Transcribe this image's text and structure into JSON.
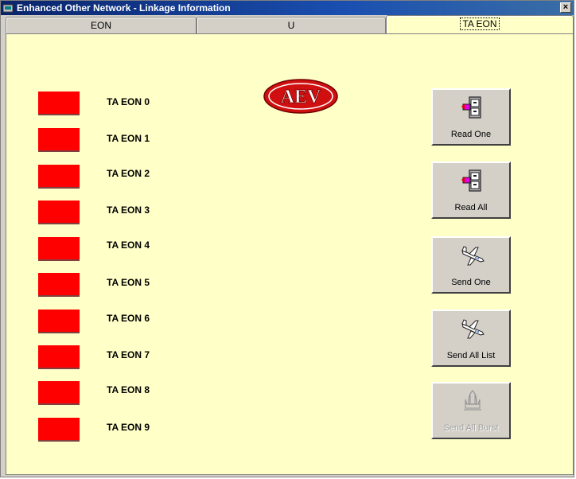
{
  "window": {
    "title": "Enhanced Other Network - Linkage Information",
    "close_glyph": "×"
  },
  "tabs": [
    {
      "label": "EON",
      "active": false
    },
    {
      "label": "U",
      "active": false
    },
    {
      "label": "TA EON",
      "active": true
    }
  ],
  "indicators": [
    {
      "label": "TA EON 0",
      "color": "#ff0000"
    },
    {
      "label": "TA EON 1",
      "color": "#ff0000"
    },
    {
      "label": "TA EON 2",
      "color": "#ff0000"
    },
    {
      "label": "TA EON 3",
      "color": "#ff0000"
    },
    {
      "label": "TA EON 4",
      "color": "#ff0000"
    },
    {
      "label": "TA EON 5",
      "color": "#ff0000"
    },
    {
      "label": "TA EON 6",
      "color": "#ff0000"
    },
    {
      "label": "TA EON 7",
      "color": "#ff0000"
    },
    {
      "label": "TA EON 8",
      "color": "#ff0000"
    },
    {
      "label": "TA EON 9",
      "color": "#ff0000"
    }
  ],
  "logo": {
    "text": "AEV",
    "icon": "aev-logo"
  },
  "buttons": [
    {
      "label": "Read One",
      "icon": "file-cabinet-icon",
      "enabled": true
    },
    {
      "label": "Read All",
      "icon": "file-cabinet-icon",
      "enabled": true
    },
    {
      "label": "Send One",
      "icon": "airplane-icon",
      "enabled": true
    },
    {
      "label": "Send All List",
      "icon": "airplane-icon",
      "enabled": true
    },
    {
      "label": "Send All Burst",
      "icon": "space-shuttle-icon",
      "enabled": false
    }
  ],
  "colors": {
    "panel_bg": "#ffffc8",
    "indicator_red": "#ff0000",
    "title_bar": "#0a246a"
  }
}
